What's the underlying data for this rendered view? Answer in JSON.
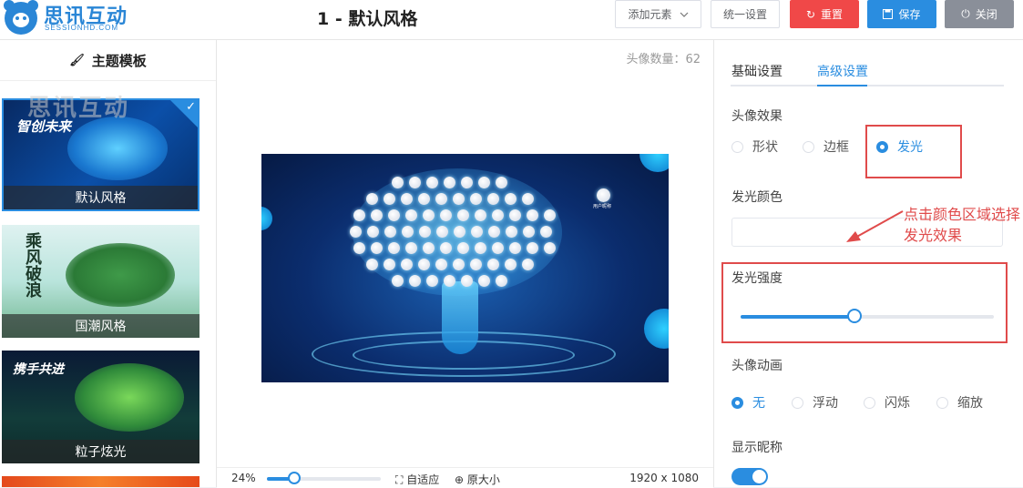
{
  "header": {
    "logo_name": "思讯互动",
    "logo_sub": "SESSIONHD.COM",
    "doc_title": "1 - 默认风格",
    "add_element_label": "添加元素",
    "unified_settings_label": "统一设置",
    "reset_label": "重置",
    "save_label": "保存",
    "close_label": "关闭"
  },
  "left_panel": {
    "title": "主题模板",
    "watermark": "思讯互动",
    "templates": [
      {
        "label": "默认风格",
        "selected": true,
        "art_text": "智创未来"
      },
      {
        "label": "国潮风格",
        "selected": false,
        "art_text": "乘风破浪"
      },
      {
        "label": "粒子炫光",
        "selected": false,
        "art_text": "携手共进"
      }
    ]
  },
  "center": {
    "avatar_count": "头像数量：62",
    "avatar_name_label": "用户昵称",
    "zoom_percent": "24%",
    "zoom_value": 0.24,
    "fit_label": "自适应",
    "original_label": "原大小",
    "resolution": "1920 x 1080"
  },
  "right_panel": {
    "tabs": [
      {
        "label": "基础设置",
        "active": false
      },
      {
        "label": "高级设置",
        "active": true
      }
    ],
    "avatar_effect": {
      "title": "头像效果",
      "options": [
        {
          "label": "形状",
          "selected": false
        },
        {
          "label": "边框",
          "selected": false
        },
        {
          "label": "发光",
          "selected": true
        }
      ]
    },
    "glow_color": {
      "title": "发光颜色"
    },
    "glow_intensity": {
      "title": "发光强度",
      "value": 0.45
    },
    "avatar_animation": {
      "title": "头像动画",
      "options": [
        {
          "label": "无",
          "selected": true
        },
        {
          "label": "浮动",
          "selected": false
        },
        {
          "label": "闪烁",
          "selected": false
        },
        {
          "label": "缩放",
          "selected": false
        }
      ]
    },
    "show_nickname": {
      "title": "显示昵称",
      "enabled": true
    }
  },
  "annotation": {
    "text": "点击颜色区域选择发光效果"
  },
  "colors": {
    "accent": "#2a8de0",
    "danger": "#f04848",
    "highlight": "#e04b4b",
    "neutral_button": "#8a8f99"
  }
}
